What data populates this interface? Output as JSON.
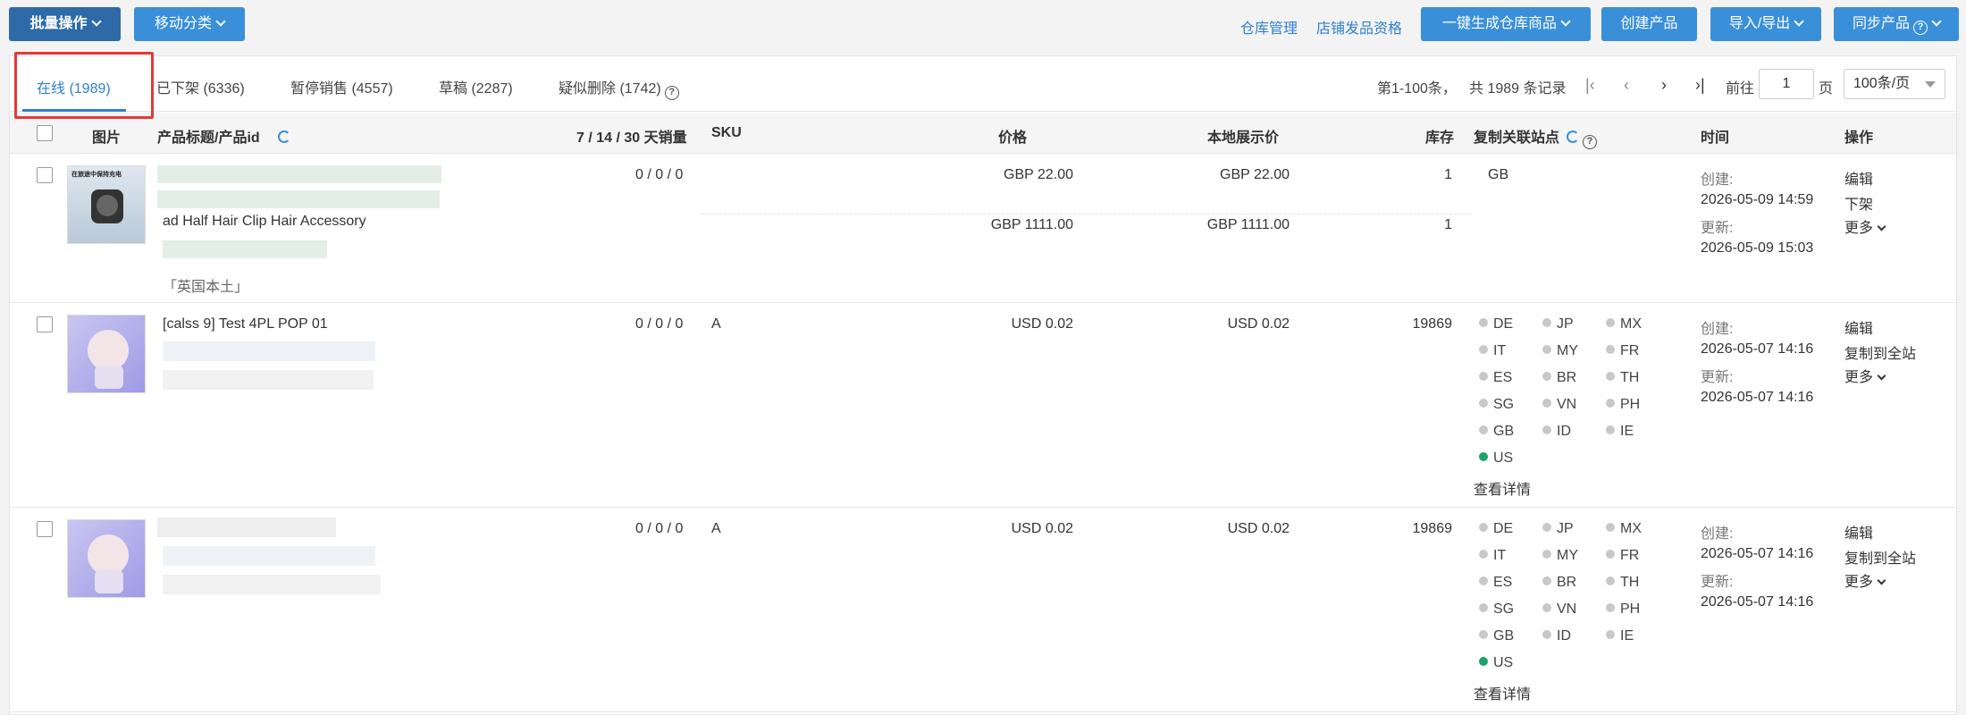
{
  "toolbar": {
    "bulk": "批量操作",
    "move": "移动分类",
    "warehouse_mgmt": "仓库管理",
    "store_qual": "店铺发品资格",
    "gen_warehouse": "一键生成仓库商品",
    "create": "创建产品",
    "import_export": "导入/导出",
    "sync": "同步产品"
  },
  "tabs": [
    {
      "label": "在线 (1989)"
    },
    {
      "label": "已下架 (6336)"
    },
    {
      "label": "暂停销售 (4557)"
    },
    {
      "label": "草稿 (2287)"
    },
    {
      "label": "疑似删除 (1742)"
    }
  ],
  "pager": {
    "range": "第1-100条，",
    "total": "共 1989 条记录",
    "goto": "前往",
    "page_value": "1",
    "page_unit": "页",
    "per_page": "100条/页"
  },
  "columns": {
    "image": "图片",
    "title": "产品标题/产品id",
    "sales": "7 / 14 / 30 天销量",
    "sku": "SKU",
    "price": "价格",
    "local_price": "本地展示价",
    "stock": "库存",
    "sites": "复制关联站点",
    "time": "时间",
    "ops": "操作"
  },
  "rows": [
    {
      "thumb_text": "在旅途中保持充电",
      "title_line": "ad Half Hair Clip Hair Accessory",
      "tag": "「英国本土」",
      "sales": "0 / 0 / 0",
      "sku": "",
      "price1": "GBP 22.00",
      "local1": "GBP 22.00",
      "stock1": "1",
      "price2": "GBP 1111.00",
      "local2": "GBP 1111.00",
      "stock2": "1",
      "site": "GB",
      "created_label": "创建:",
      "created": "2026-05-09 14:59",
      "updated_label": "更新:",
      "updated": "2026-05-09 15:03",
      "op1": "编辑",
      "op2": "下架",
      "more": "更多"
    },
    {
      "title_line": "[calss 9] Test 4PL POP 01",
      "sales": "0 / 0 / 0",
      "sku": "A",
      "price": "USD 0.02",
      "local": "USD 0.02",
      "stock": "19869",
      "created_label": "创建:",
      "created": "2026-05-07 14:16",
      "updated_label": "更新:",
      "updated": "2026-05-07 14:16",
      "op1": "编辑",
      "op2": "复制到全站",
      "more": "更多",
      "detail": "查看详情"
    },
    {
      "sales": "0 / 0 / 0",
      "sku": "A",
      "price": "USD 0.02",
      "local": "USD 0.02",
      "stock": "19869",
      "created_label": "创建:",
      "created": "2026-05-07 14:16",
      "updated_label": "更新:",
      "updated": "2026-05-07 14:16",
      "op1": "编辑",
      "op2": "复制到全站",
      "more": "更多",
      "detail": "查看详情"
    }
  ],
  "sites_grid": [
    "DE",
    "JP",
    "MX",
    "IT",
    "MY",
    "FR",
    "ES",
    "BR",
    "TH",
    "SG",
    "VN",
    "PH",
    "GB",
    "ID",
    "IE",
    "US"
  ],
  "active_site": "US"
}
